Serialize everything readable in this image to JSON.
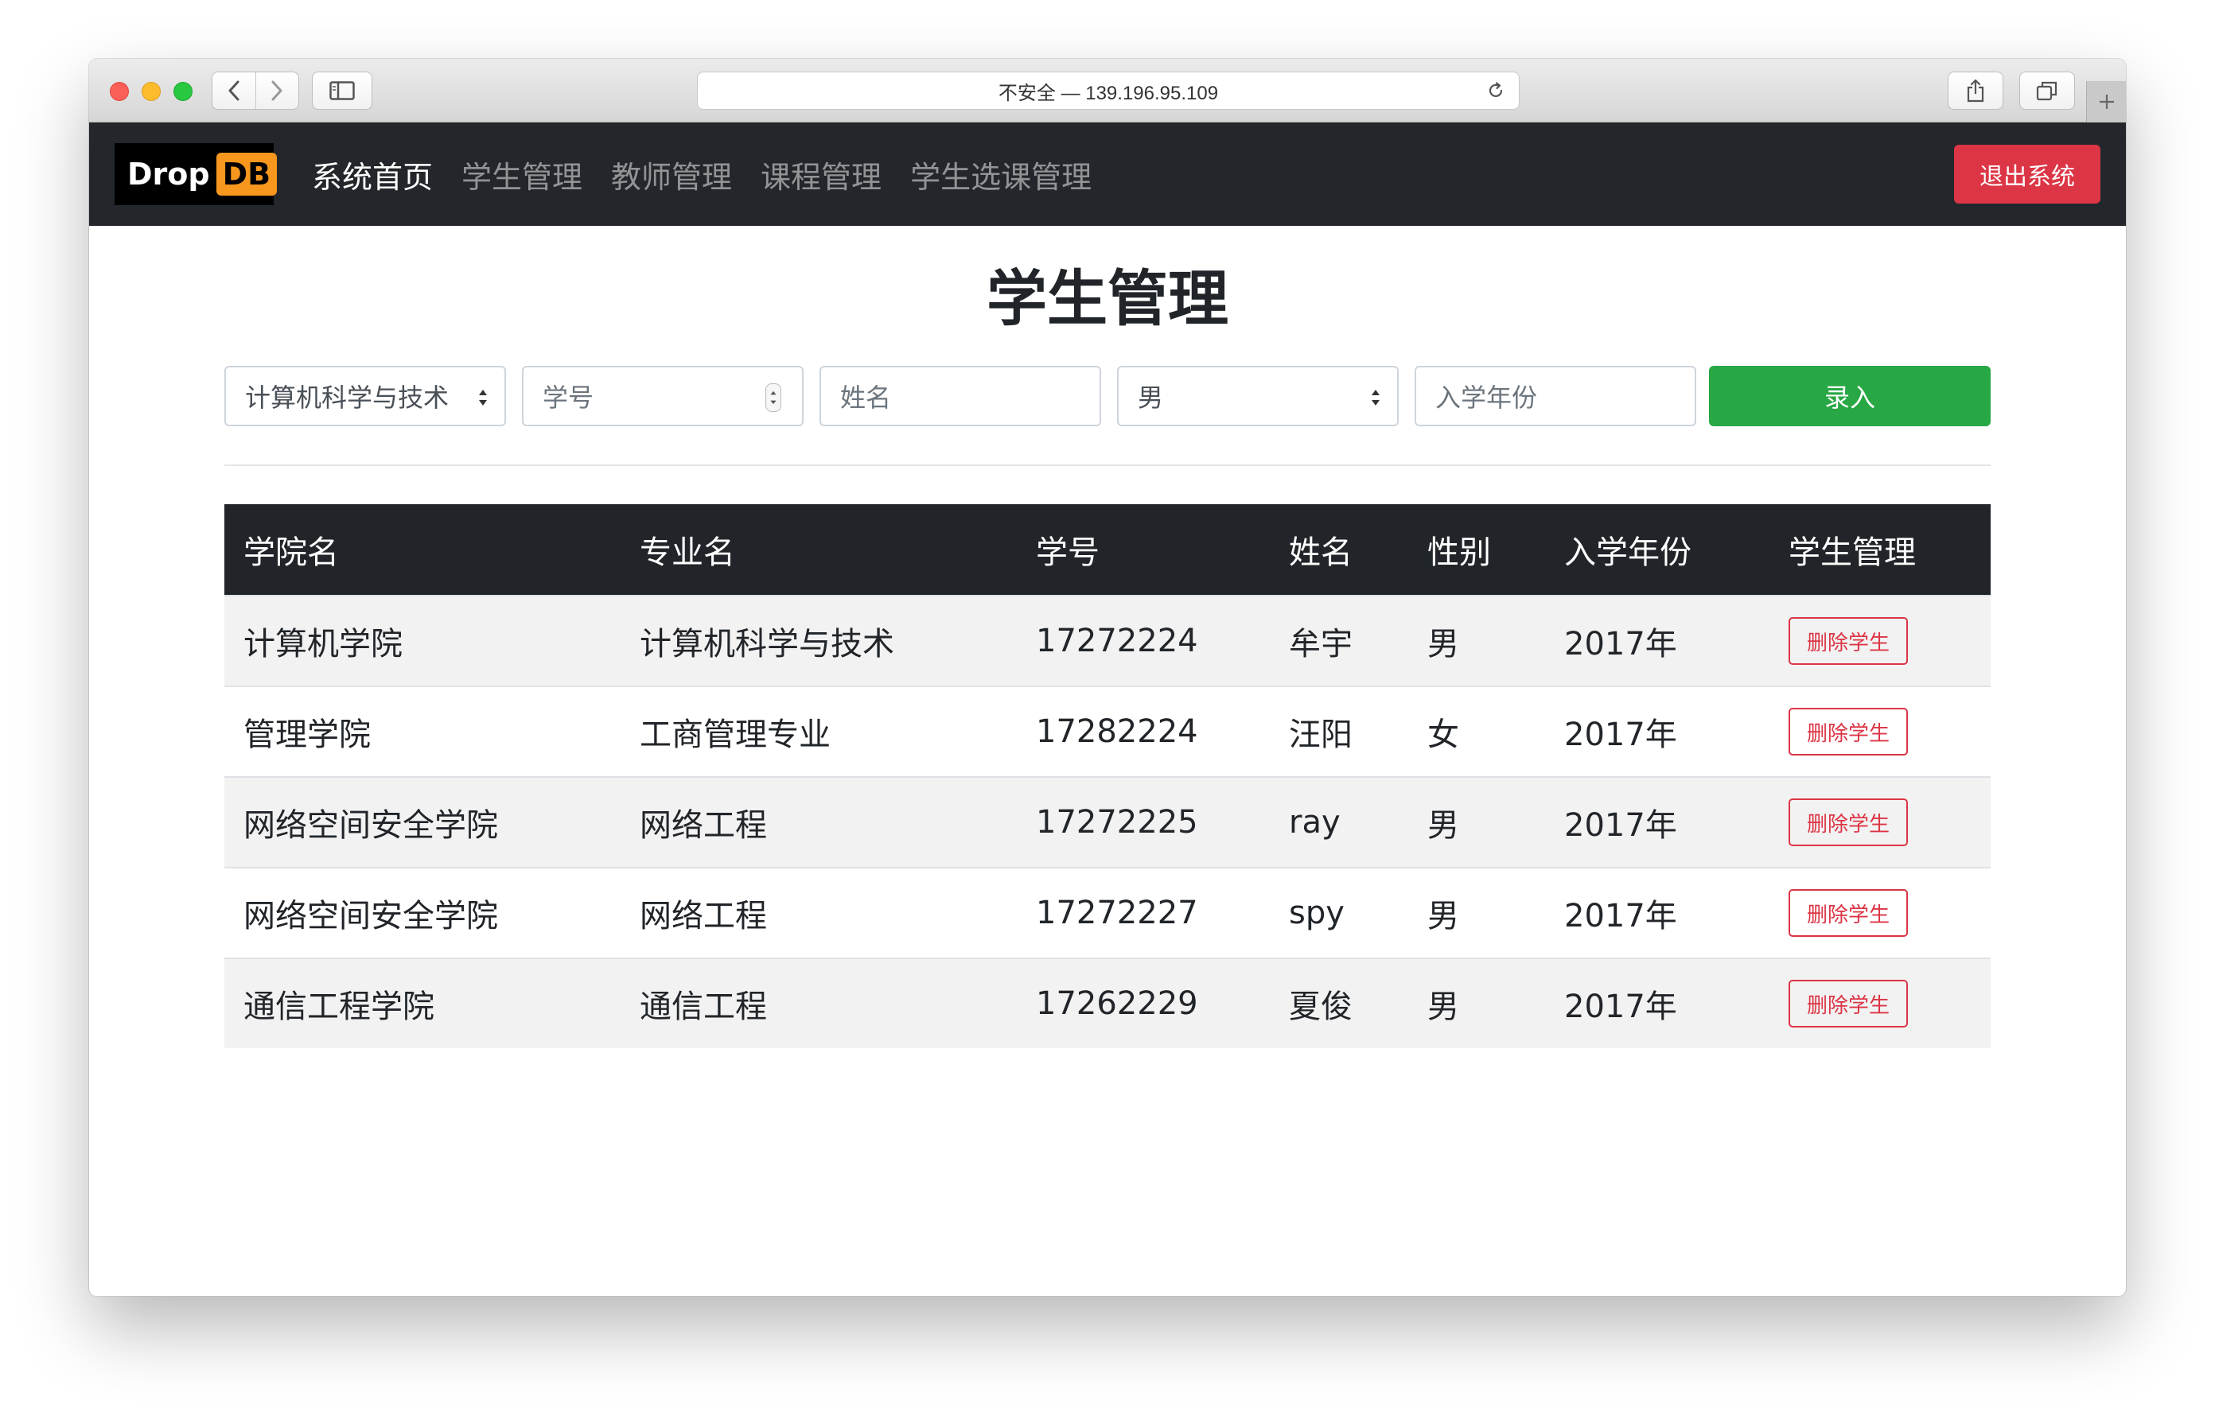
{
  "browser": {
    "address": "不安全 — 139.196.95.109"
  },
  "navbar": {
    "brand_main": "Drop",
    "brand_accent": "DB",
    "links": [
      {
        "label": "系统首页",
        "active": true
      },
      {
        "label": "学生管理",
        "active": false
      },
      {
        "label": "教师管理",
        "active": false
      },
      {
        "label": "课程管理",
        "active": false
      },
      {
        "label": "学生选课管理",
        "active": false
      }
    ],
    "logout_label": "退出系统"
  },
  "page": {
    "title": "学生管理"
  },
  "form": {
    "major_selected": "计算机科学与技术",
    "student_id_placeholder": "学号",
    "name_placeholder": "姓名",
    "gender_selected": "男",
    "year_placeholder": "入学年份",
    "submit_label": "录入"
  },
  "table": {
    "headers": [
      "学院名",
      "专业名",
      "学号",
      "姓名",
      "性别",
      "入学年份",
      "学生管理"
    ],
    "rows": [
      {
        "college": "计算机学院",
        "major": "计算机科学与技术",
        "id": "17272224",
        "name": "牟宇",
        "gender": "男",
        "year": "2017年",
        "action": "删除学生"
      },
      {
        "college": "管理学院",
        "major": "工商管理专业",
        "id": "17282224",
        "name": "汪阳",
        "gender": "女",
        "year": "2017年",
        "action": "删除学生"
      },
      {
        "college": "网络空间安全学院",
        "major": "网络工程",
        "id": "17272225",
        "name": "ray",
        "gender": "男",
        "year": "2017年",
        "action": "删除学生"
      },
      {
        "college": "网络空间安全学院",
        "major": "网络工程",
        "id": "17272227",
        "name": "spy",
        "gender": "男",
        "year": "2017年",
        "action": "删除学生"
      },
      {
        "college": "通信工程学院",
        "major": "通信工程",
        "id": "17262229",
        "name": "夏俊",
        "gender": "男",
        "year": "2017年",
        "action": "删除学生"
      }
    ]
  },
  "colors": {
    "navbar_bg": "#23272b",
    "danger": "#dc3545",
    "success": "#28a745",
    "brand_accent": "#f7971e",
    "table_head_bg": "#212529"
  },
  "icons": {
    "back": "chevron-left-icon",
    "forward": "chevron-right-icon",
    "sidebar": "sidebar-icon",
    "reload": "reload-icon",
    "share": "share-icon",
    "tabs": "tabs-icon",
    "new_tab": "plus-icon",
    "select_caret": "sort-caret-icon",
    "number_spinner": "spinner-icon"
  }
}
